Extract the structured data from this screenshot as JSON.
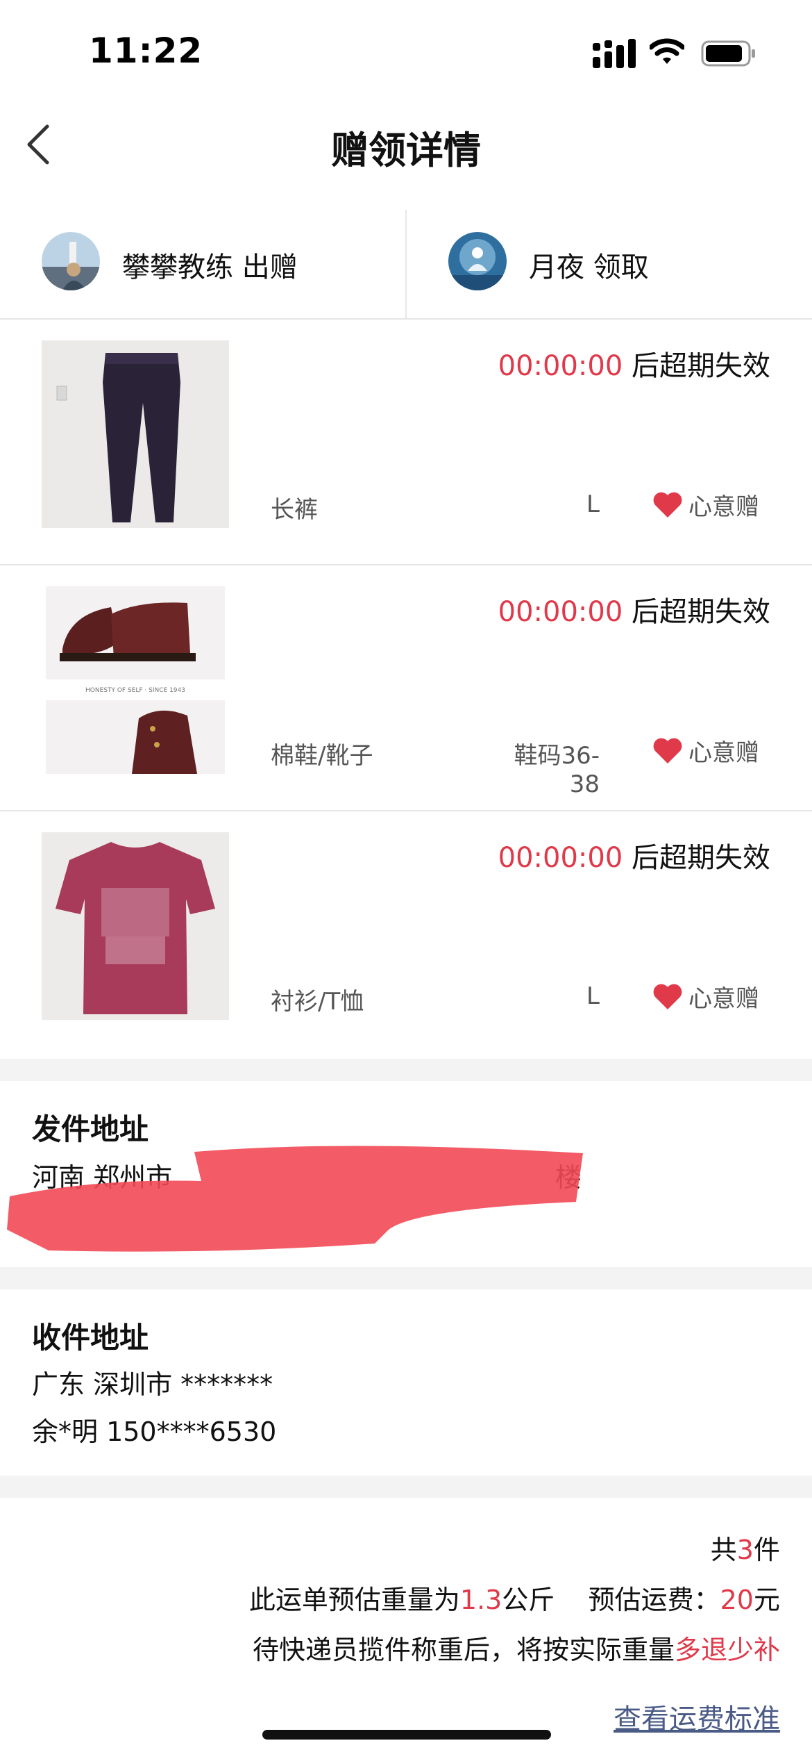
{
  "status_bar": {
    "time": "11:22"
  },
  "nav": {
    "title": "赠领详情"
  },
  "users": {
    "giver": {
      "name": "攀攀教练",
      "action": "出赠"
    },
    "receiver": {
      "name": "月夜",
      "action": "领取"
    }
  },
  "items": [
    {
      "timer": "00:00:00",
      "timer_suffix": "后超期失效",
      "category": "长裤",
      "size": "L",
      "gift_label": "心意赠"
    },
    {
      "timer": "00:00:00",
      "timer_suffix": "后超期失效",
      "category": "棉鞋/靴子",
      "size": "鞋码36-38",
      "gift_label": "心意赠",
      "image_caption": "HONESTY OF SELF · SINCE 1943"
    },
    {
      "timer": "00:00:00",
      "timer_suffix": "后超期失效",
      "category": "衬衫/T恤",
      "size": "L",
      "gift_label": "心意赠"
    }
  ],
  "sender": {
    "title": "发件地址",
    "line1_start": "河南 郑州市",
    "line1_end": "楼"
  },
  "receiver_address": {
    "title": "收件地址",
    "line1": "广东 深圳市 *******",
    "line2": "余*明 150****6530"
  },
  "summary": {
    "count_prefix": "共",
    "count": "3",
    "count_suffix": "件",
    "weight_prefix": "此运单预估重量为",
    "weight": "1.3",
    "weight_unit": "公斤",
    "fee_prefix": "预估运费：",
    "fee": "20",
    "fee_unit": "元",
    "note_prefix": "待快递员揽件称重后，将按实际重量",
    "note_highlight": "多退少补",
    "link": "查看运费标准"
  },
  "colors": {
    "accent_red": "#e0394a",
    "link_blue": "#4a5b86"
  }
}
